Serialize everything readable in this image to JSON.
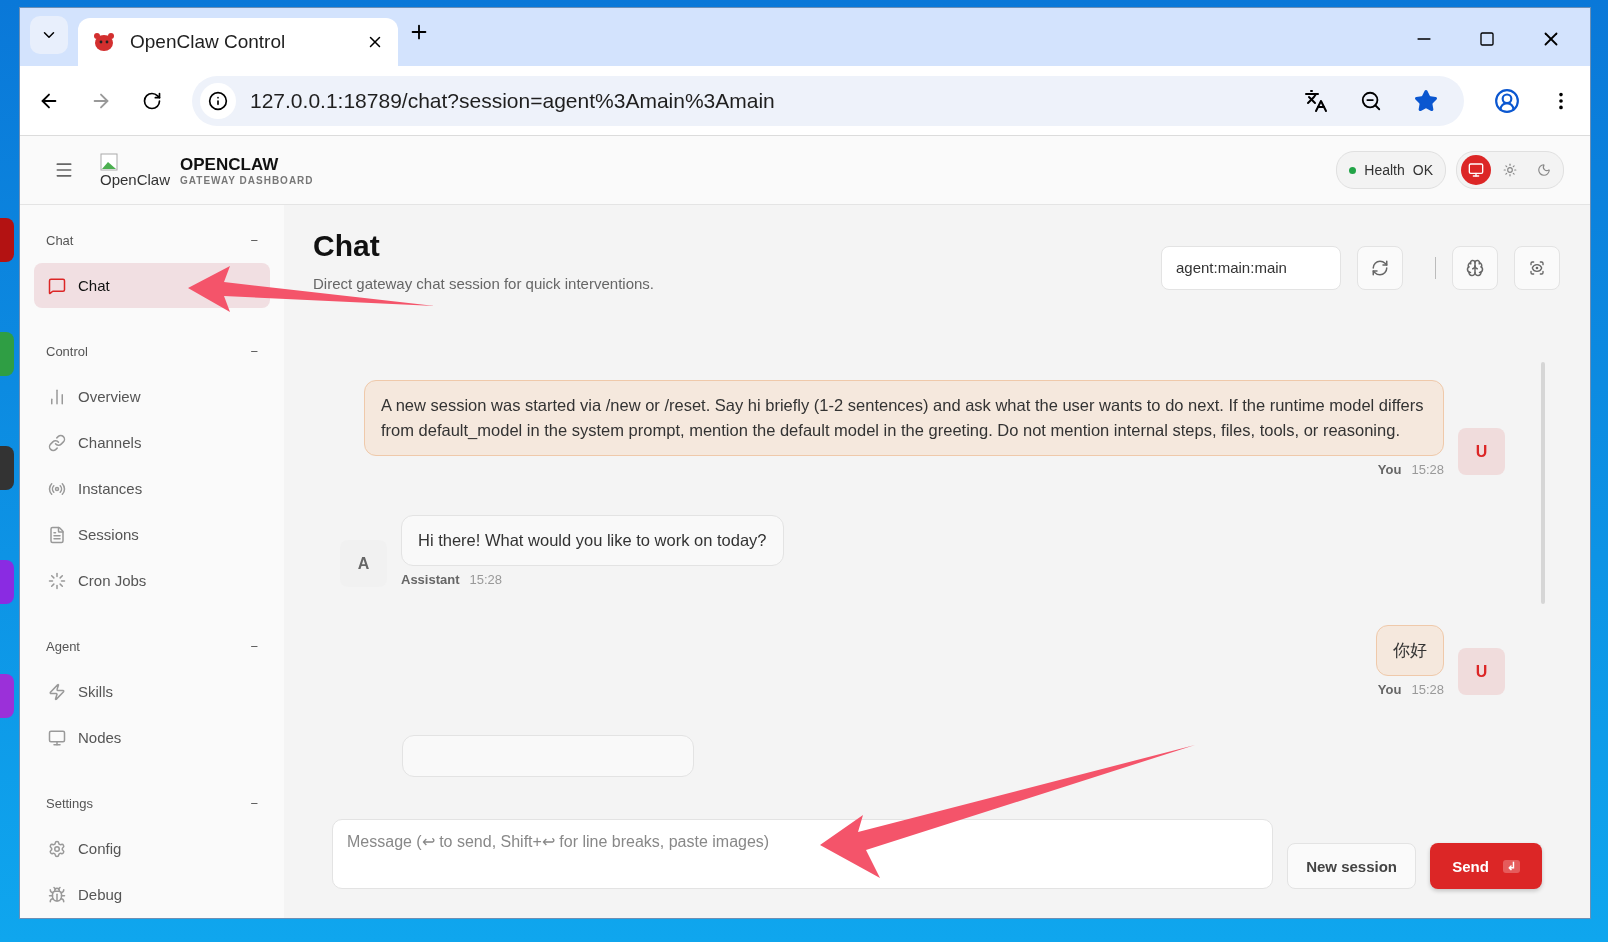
{
  "browser": {
    "tabs": [
      {
        "title": "OpenClaw Control",
        "selected": true
      }
    ],
    "url": "127.0.0.1:18789/chat?session=agent%3Amain%3Amain"
  },
  "header": {
    "logo_alt": "OpenClaw",
    "brand": "OPENCLAW",
    "tagline": "GATEWAY DASHBOARD",
    "health": {
      "label": "Health",
      "value": "OK",
      "color": "#22a447"
    },
    "theme_modes": [
      {
        "kind": "system",
        "selected": true
      },
      {
        "kind": "light",
        "selected": false
      },
      {
        "kind": "dark",
        "selected": false
      }
    ]
  },
  "sidebar": {
    "groups": [
      {
        "title": "Chat",
        "toggle": "−",
        "items": [
          {
            "label": "Chat",
            "kind": "chat",
            "selected": true
          }
        ]
      },
      {
        "title": "Control",
        "toggle": "−",
        "items": [
          {
            "label": "Overview",
            "kind": "overview",
            "selected": false
          },
          {
            "label": "Channels",
            "kind": "channels",
            "selected": false
          },
          {
            "label": "Instances",
            "kind": "instances",
            "selected": false
          },
          {
            "label": "Sessions",
            "kind": "sessions",
            "selected": false
          },
          {
            "label": "Cron Jobs",
            "kind": "cron",
            "selected": false
          }
        ]
      },
      {
        "title": "Agent",
        "toggle": "−",
        "items": [
          {
            "label": "Skills",
            "kind": "skills",
            "selected": false
          },
          {
            "label": "Nodes",
            "kind": "nodes",
            "selected": false
          }
        ]
      },
      {
        "title": "Settings",
        "toggle": "−",
        "items": [
          {
            "label": "Config",
            "kind": "config",
            "selected": false
          },
          {
            "label": "Debug",
            "kind": "debug",
            "selected": false
          }
        ]
      }
    ]
  },
  "page": {
    "title": "Chat",
    "subtitle": "Direct gateway chat session for quick interventions.",
    "session": "agent:main:main"
  },
  "messages": [
    {
      "kind": "user",
      "text": "A new session was started via /new or /reset. Say hi briefly (1-2 sentences) and ask what the user wants to do next. If the runtime model differs from default_model in the system prompt, mention the default model in the greeting. Do not mention internal steps, files, tools, or reasoning.",
      "sender": "You",
      "time": "15:28",
      "avatar": "U"
    },
    {
      "kind": "assistant",
      "text": "Hi there! What would you like to work on today?",
      "sender": "Assistant",
      "time": "15:28",
      "avatar": "A"
    },
    {
      "kind": "user",
      "text": "你好",
      "sender": "You",
      "time": "15:28",
      "avatar": "U"
    },
    {
      "kind": "partial"
    }
  ],
  "composer": {
    "placeholder": "Message (↩ to send, Shift+↩ for line breaks, paste images)",
    "new_session": "New session",
    "send": "Send",
    "send_key": "↲"
  }
}
